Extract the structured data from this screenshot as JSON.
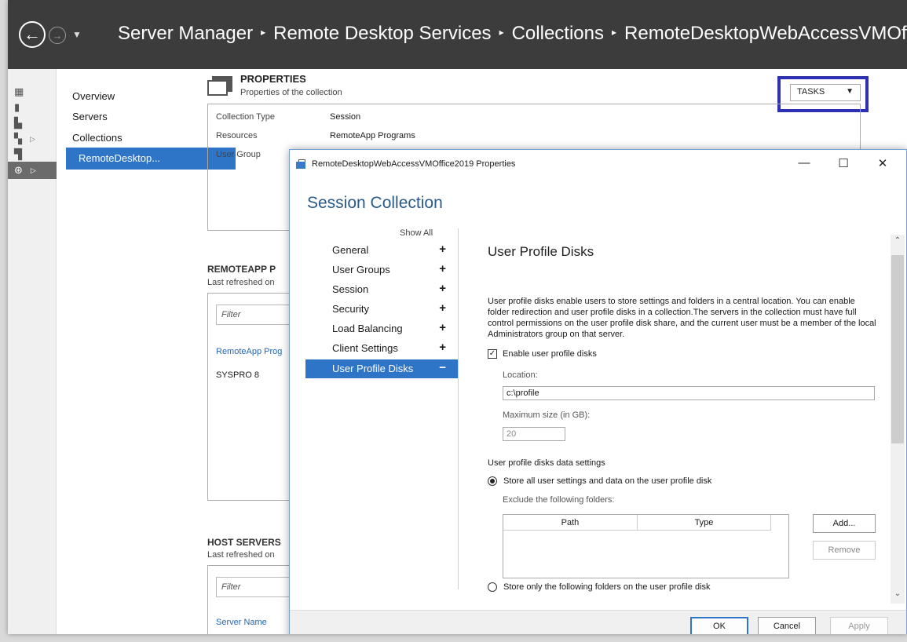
{
  "titlebar": {
    "breadcrumb": [
      "Server Manager",
      "Remote Desktop Services",
      "Collections",
      "RemoteDesktopWebAccessVMOffi"
    ],
    "separator": "▸"
  },
  "nav": {
    "items": [
      "Overview",
      "Servers",
      "Collections"
    ],
    "selected": "RemoteDesktop..."
  },
  "properties": {
    "title": "PROPERTIES",
    "subtitle": "Properties of the collection",
    "tasks_label": "TASKS",
    "rows": [
      {
        "key": "Collection Type",
        "value": "Session"
      },
      {
        "key": "Resources",
        "value": "RemoteApp Programs"
      },
      {
        "key": "User Group",
        "value": ""
      }
    ]
  },
  "remoteapp": {
    "title": "REMOTEAPP P",
    "subtitle": "Last refreshed on",
    "filter_placeholder": "Filter",
    "column": "RemoteApp Prog",
    "rows": [
      "SYSPRO 8"
    ]
  },
  "hostservers": {
    "title": "HOST SERVERS",
    "subtitle": "Last refreshed on",
    "filter_placeholder": "Filter",
    "column": "Server Name"
  },
  "dialog": {
    "title": "RemoteDesktopWebAccessVMOffice2019 Properties",
    "heading": "Session Collection",
    "show_all": "Show All",
    "nav": [
      {
        "label": "General",
        "sign": "+"
      },
      {
        "label": "User Groups",
        "sign": "+"
      },
      {
        "label": "Session",
        "sign": "+"
      },
      {
        "label": "Security",
        "sign": "+"
      },
      {
        "label": "Load Balancing",
        "sign": "+"
      },
      {
        "label": "Client Settings",
        "sign": "+"
      },
      {
        "label": "User Profile Disks",
        "sign": "−"
      }
    ],
    "content": {
      "heading": "User Profile Disks",
      "description": "User profile disks enable users to store settings and folders in a central location. You can enable folder redirection and user profile disks in a collection.The servers in the collection must have full control permissions on the user profile disk share, and the current user must be a member of the local Administrators group on that server.",
      "enable_label": "Enable user profile disks",
      "enable_checked": true,
      "location_label": "Location:",
      "location_value": "c:\\profile",
      "maxsize_label": "Maximum size (in GB):",
      "maxsize_value": "20",
      "data_settings_label": "User profile disks data settings",
      "radio_all": "Store all user settings and data on the user profile disk",
      "exclude_label": "Exclude the following folders:",
      "table_headers": [
        "Path",
        "Type"
      ],
      "add_label": "Add...",
      "remove_label": "Remove",
      "radio_only": "Store only the following folders on the user profile disk"
    },
    "footer": {
      "ok": "OK",
      "cancel": "Cancel",
      "apply": "Apply"
    }
  }
}
